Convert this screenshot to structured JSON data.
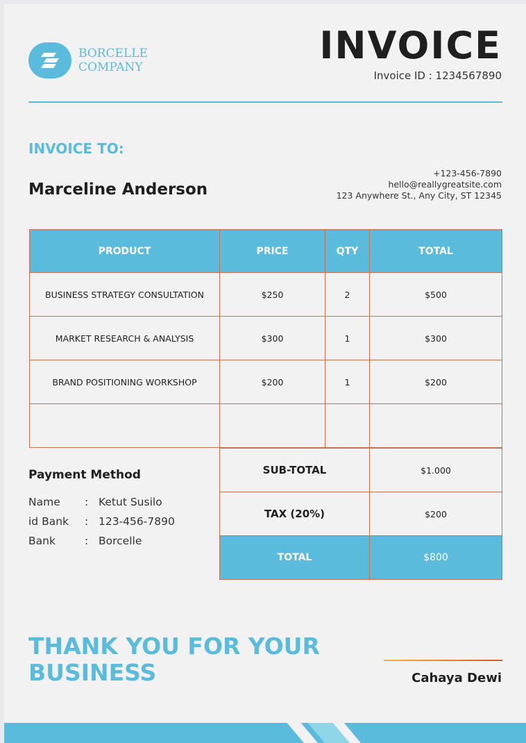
{
  "company": {
    "name_line1": "BORCELLE",
    "name_line2": "COMPANY",
    "logo_icon": "stacked-slash-logo-icon"
  },
  "invoice": {
    "title": "INVOICE",
    "id_text": "Invoice ID : 1234567890"
  },
  "bill_to": {
    "heading": "INVOICE TO:",
    "name": "Marceline Anderson"
  },
  "contact": {
    "phone": "+123-456-7890",
    "email": "hello@reallygreatsite.com",
    "address": "123 Anywhere St., Any City, ST 12345"
  },
  "table": {
    "headers": [
      "PRODUCT",
      "PRICE",
      "QTY",
      "TOTAL"
    ],
    "rows": [
      [
        "BUSINESS STRATEGY CONSULTATION",
        "$250",
        "2",
        "$500"
      ],
      [
        "MARKET RESEARCH & ANALYSIS",
        "$300",
        "1",
        "$300"
      ],
      [
        "BRAND POSITIONING WORKSHOP",
        "$200",
        "1",
        "$200"
      ],
      [
        "",
        "",
        "",
        ""
      ]
    ]
  },
  "payment": {
    "title": "Payment Method",
    "rows": [
      {
        "label": "Name",
        "sep": ":",
        "value": "Ketut Susilo"
      },
      {
        "label": "id Bank",
        "sep": ":",
        "value": "123-456-7890"
      },
      {
        "label": "Bank",
        "sep": ":",
        "value": "Borcelle"
      }
    ]
  },
  "totals": {
    "subtotal_label": "SUB-TOTAL",
    "subtotal_value": "$1.000",
    "tax_label": "TAX (20%)",
    "tax_value": "$200",
    "total_label": "TOTAL",
    "total_value": "$800"
  },
  "footer": {
    "thanks_line1": "THANK YOU FOR YOUR",
    "thanks_line2": "BUSINESS",
    "signer": "Cahaya Dewi"
  },
  "colors": {
    "accent": "#5bbbdc",
    "border": "#c8734e",
    "text": "#1f1f1f",
    "background": "#f2f2f2",
    "signature_gradient": [
      "#f3b43c",
      "#d8582c"
    ]
  }
}
